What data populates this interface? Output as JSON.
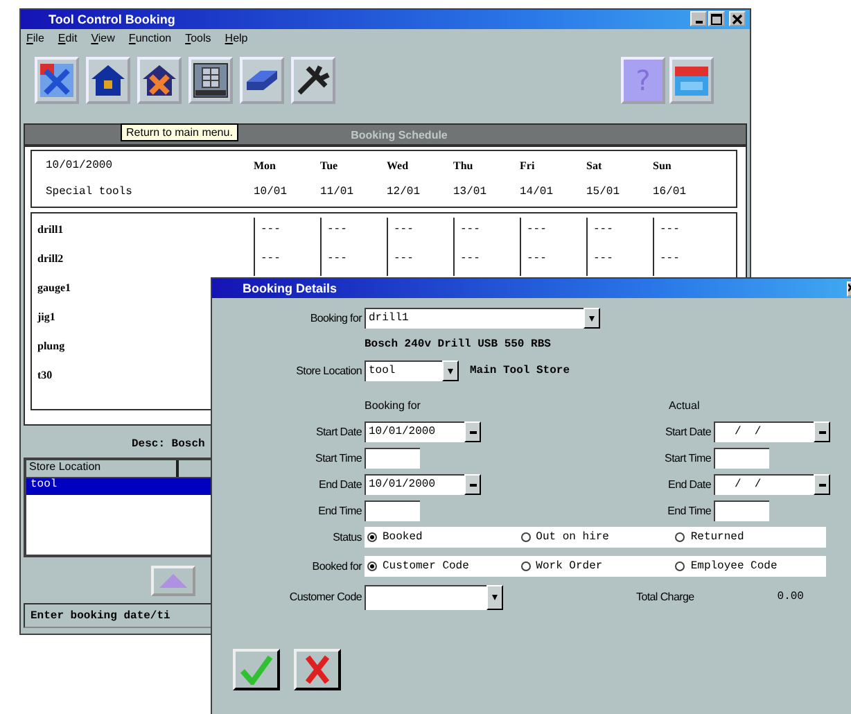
{
  "main_window": {
    "title": "Tool Control Booking",
    "menu": [
      "File",
      "Edit",
      "View",
      "Function",
      "Tools",
      "Help"
    ],
    "toolbar": [
      {
        "kind": "map"
      },
      {
        "kind": "house"
      },
      {
        "kind": "house-cross"
      },
      {
        "kind": "grid"
      },
      {
        "kind": "tray"
      },
      {
        "kind": "tools"
      }
    ],
    "help_button": "?",
    "tooltip": "Return to main menu.",
    "schedule": {
      "title": "Booking Schedule",
      "date": "10/01/2000",
      "group": "Special tools",
      "days": [
        {
          "day": "Mon",
          "date": "10/01"
        },
        {
          "day": "Tue",
          "date": "11/01"
        },
        {
          "day": "Wed",
          "date": "12/01"
        },
        {
          "day": "Thu",
          "date": "13/01"
        },
        {
          "day": "Fri",
          "date": "14/01"
        },
        {
          "day": "Sat",
          "date": "15/01"
        },
        {
          "day": "Sun",
          "date": "16/01"
        }
      ],
      "rows": [
        {
          "tool": "drill1",
          "cells": [
            "---",
            "---",
            "---",
            "---",
            "---",
            "---",
            "---"
          ]
        },
        {
          "tool": "drill2",
          "cells": [
            "---",
            "---",
            "---",
            "---",
            "---",
            "---",
            "---"
          ]
        },
        {
          "tool": "gauge1"
        },
        {
          "tool": "jig1"
        },
        {
          "tool": "plung"
        },
        {
          "tool": "t30"
        }
      ]
    },
    "description": "Desc: Bosch",
    "store_list": {
      "columns": [
        "Store Location"
      ],
      "rows": [
        {
          "value": "tool",
          "selected": true
        }
      ]
    },
    "status_bar": "Enter booking date/ti"
  },
  "dialog": {
    "title": "Booking Details",
    "booking_for": {
      "label": "Booking for",
      "value": "drill1"
    },
    "tool_description": "Bosch 240v Drill USB 550 RBS",
    "store_location": {
      "label": "Store Location",
      "value": "tool",
      "name": "Main Tool Store"
    },
    "booking_heading": "Booking for",
    "actual_heading": "Actual",
    "date_rows": [
      {
        "label": "Start Date",
        "kind": "date",
        "booking": "10/01/2000",
        "actual_label": "Start Date",
        "actual": "/  /"
      },
      {
        "label": "Start Time",
        "kind": "time",
        "actual_label": "Start Time"
      },
      {
        "label": "End Date",
        "kind": "date",
        "booking": "10/01/2000",
        "actual_label": "End Date",
        "actual": "/  /"
      },
      {
        "label": "End Time",
        "kind": "time",
        "actual_label": "End Time"
      }
    ],
    "status": {
      "label": "Status",
      "options": [
        {
          "label": "Booked",
          "selected": true
        },
        {
          "label": "Out on hire",
          "selected": false
        },
        {
          "label": "Returned",
          "selected": false
        }
      ]
    },
    "booked_for": {
      "label": "Booked for",
      "options": [
        {
          "label": "Customer Code",
          "selected": true
        },
        {
          "label": "Work Order",
          "selected": false
        },
        {
          "label": "Employee Code",
          "selected": false
        }
      ]
    },
    "customer_code": {
      "label": "Customer Code"
    },
    "total_charge": {
      "label": "Total Charge",
      "value": "0.00"
    }
  }
}
